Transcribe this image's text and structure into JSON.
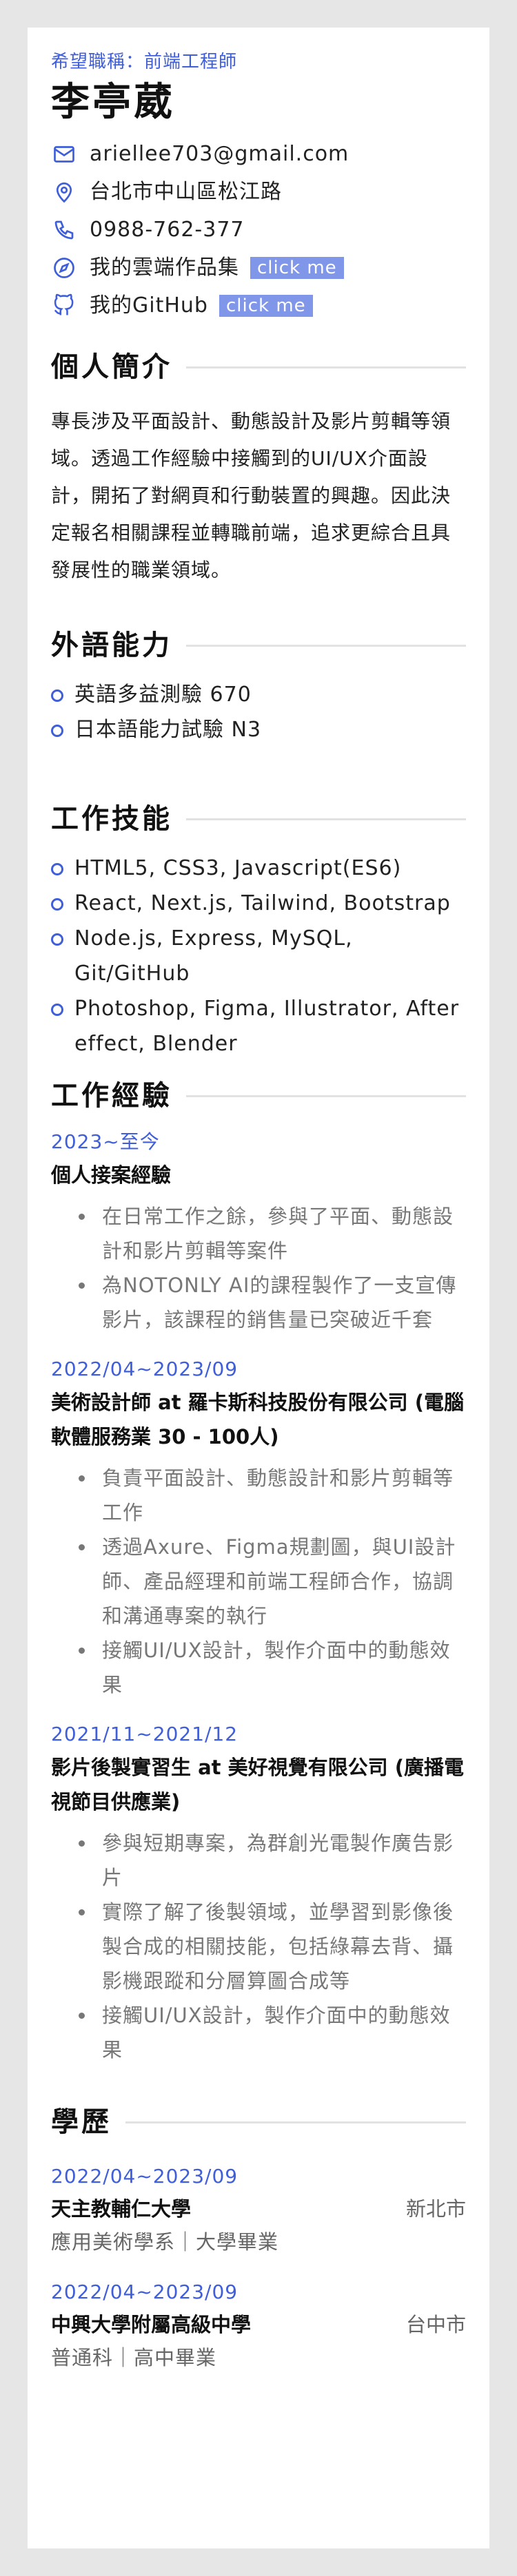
{
  "header": {
    "wanted_position": "希望職稱：前端工程師",
    "name": "李亭葳"
  },
  "contacts": {
    "email": "ariellee703@gmail.com",
    "address": "台北市中山區松江路",
    "phone": "0988-762-377",
    "portfolio_label": "我的雲端作品集",
    "portfolio_link": "click me",
    "github_label": "我的GitHub",
    "github_link": "click me"
  },
  "profile": {
    "title": "個人簡介",
    "text": "專長涉及平面設計、動態設計及影片剪輯等領域。透過工作經驗中接觸到的UI/UX介面設計，開拓了對網頁和行動裝置的興趣。因此決定報名相關課程並轉職前端，追求更綜合且具發展性的職業領域。"
  },
  "languages": {
    "title": "外語能力",
    "items": [
      "英語多益測驗 670",
      "日本語能力試驗 N3"
    ]
  },
  "skills": {
    "title": "工作技能",
    "items": [
      "HTML5, CSS3, Javascript(ES6)",
      "React, Next.js, Tailwind, Bootstrap",
      "Node.js, Express, MySQL, Git/GitHub",
      "Photoshop, Figma, Illustrator, After effect, Blender"
    ]
  },
  "experience": {
    "title": "工作經驗",
    "jobs": [
      {
        "date": "2023~至今",
        "title": "個人接案經驗",
        "bullets": [
          "在日常工作之餘，參與了平面、動態設計和影片剪輯等案件",
          "為NOTONLY AI的課程製作了一支宣傳影片，該課程的銷售量已突破近千套"
        ]
      },
      {
        "date": "2022/04~2023/09",
        "title": "美術設計師 at 羅卡斯科技股份有限公司 (電腦軟體服務業 30 - 100人)",
        "bullets": [
          "負責平面設計、動態設計和影片剪輯等工作",
          "透過Axure、Figma規劃圖，與UI設計師、產品經理和前端工程師合作，協調和溝通專案的執行",
          "接觸UI/UX設計，製作介面中的動態效果"
        ]
      },
      {
        "date": "2021/11~2021/12",
        "title": "影片後製實習生 at 美好視覺有限公司 (廣播電視節目供應業)",
        "bullets": [
          "參與短期專案，為群創光電製作廣告影片",
          "實際了解了後製領域，並學習到影像後製合成的相關技能，包括綠幕去背、攝影機跟蹤和分層算圖合成等",
          "接觸UI/UX設計，製作介面中的動態效果"
        ]
      }
    ]
  },
  "education": {
    "title": "學歷",
    "items": [
      {
        "date": "2022/04~2023/09",
        "school": "天主教輔仁大學",
        "city": "新北市",
        "detail": "應用美術學系｜大學畢業"
      },
      {
        "date": "2022/04~2023/09",
        "school": "中興大學附屬高級中學",
        "city": "台中市",
        "detail": "普通科｜高中畢業"
      }
    ]
  },
  "colors": {
    "accent": "#3f5ed8",
    "chip": "#8096e8",
    "page_bg": "#e6e6e6"
  }
}
